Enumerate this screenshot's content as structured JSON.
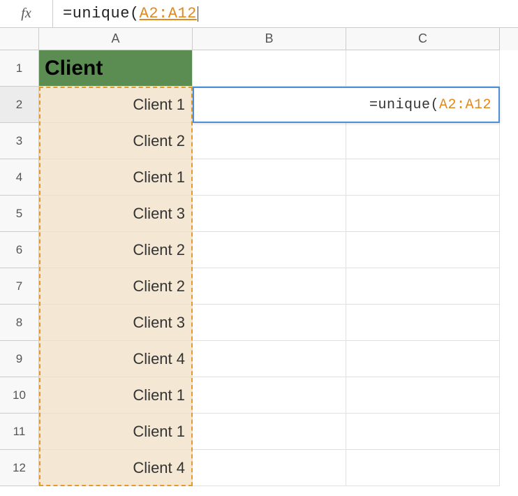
{
  "formula_bar": {
    "fx_label": "fx",
    "prefix": "=unique(",
    "reference": "A2:A12"
  },
  "columns": [
    "A",
    "B",
    "C"
  ],
  "rows": [
    "1",
    "2",
    "3",
    "4",
    "5",
    "6",
    "7",
    "8",
    "9",
    "10",
    "11",
    "12"
  ],
  "header_cell": "Client",
  "data_A": [
    "Client 1",
    "Client 2",
    "Client 1",
    "Client 3",
    "Client 2",
    "Client 2",
    "Client 3",
    "Client 4",
    "Client 1",
    "Client 1",
    "Client 4"
  ],
  "active_edit": {
    "prefix": "=unique(",
    "reference": "A2:A12"
  }
}
